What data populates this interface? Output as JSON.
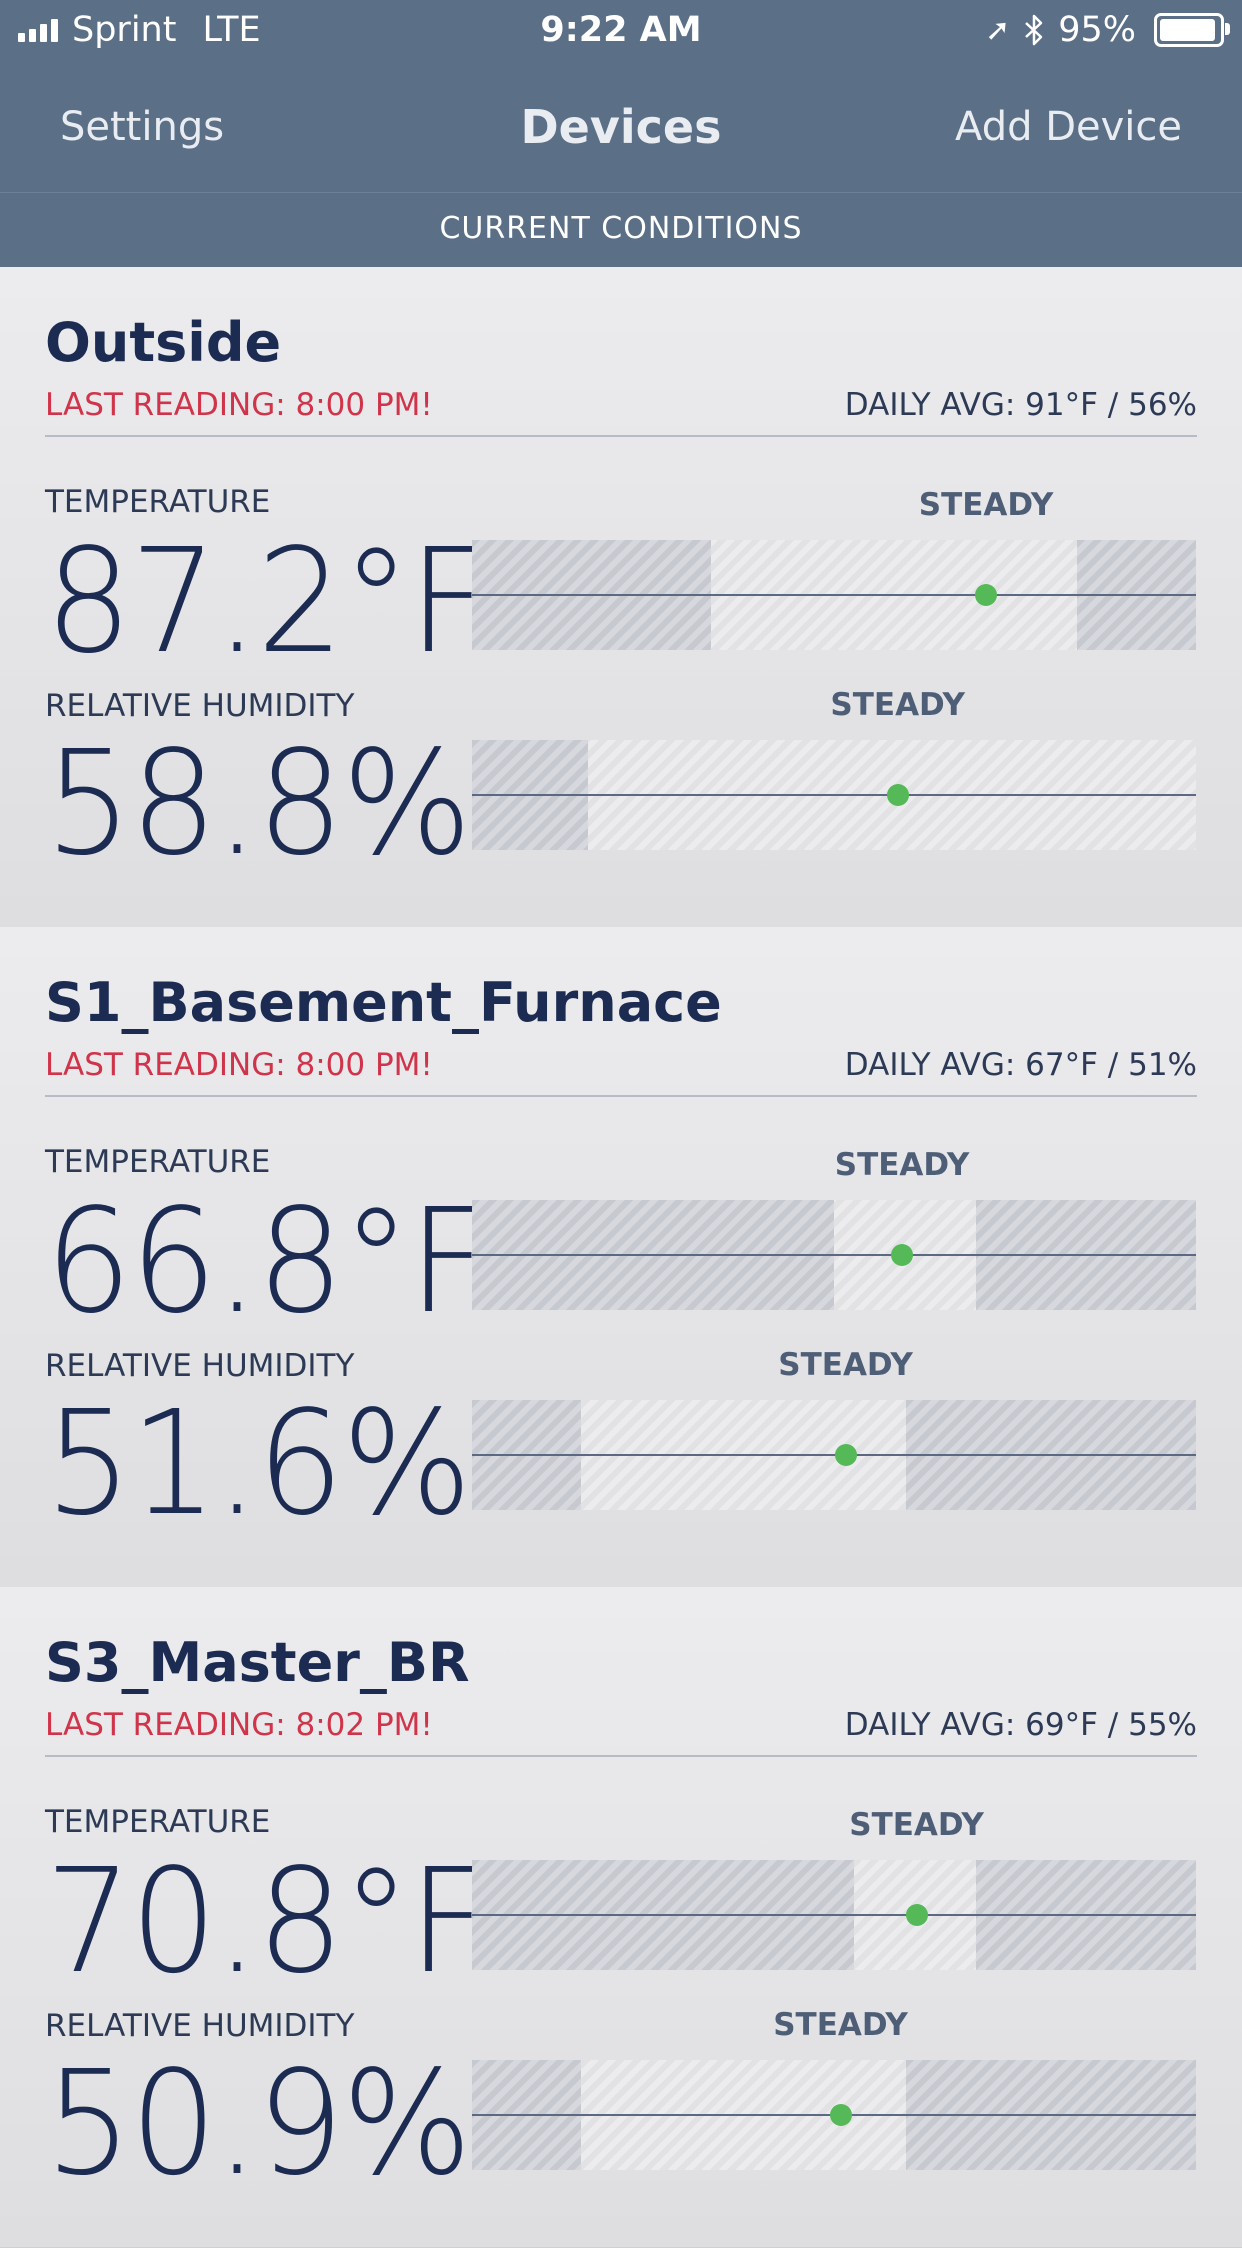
{
  "status_bar": {
    "carrier": "Sprint",
    "network": "LTE",
    "time": "9:22 AM",
    "battery": "95%",
    "battery_level": 0.95,
    "icons": [
      "signal-icon",
      "location-arrow-icon",
      "bluetooth-icon",
      "battery-icon"
    ]
  },
  "nav": {
    "left": "Settings",
    "title": "Devices",
    "right": "Add Device"
  },
  "subheader": "CURRENT CONDITIONS",
  "colors": {
    "nav_bar": "#5b6f87",
    "title_text": "#1c2b52",
    "warning_text": "#d0344a",
    "indicator": "#55b958"
  },
  "devices": [
    {
      "name": "Outside",
      "last_reading": "LAST READING: 8:00 PM!",
      "daily_avg": "DAILY AVG: 91°F / 56%",
      "temperature": {
        "label": "TEMPERATURE",
        "value": "87.2°F",
        "trend": "STEADY",
        "indicator_pos": 0.71,
        "out_of_range": [
          [
            0,
            0.33
          ],
          [
            0.835,
            1
          ]
        ]
      },
      "humidity": {
        "label": "RELATIVE HUMIDITY",
        "value": "58.8%",
        "trend": "STEADY",
        "indicator_pos": 0.588,
        "out_of_range": [
          [
            0,
            0.16
          ]
        ]
      }
    },
    {
      "name": "S1_Basement_Furnace",
      "last_reading": "LAST READING: 8:00 PM!",
      "daily_avg": "DAILY AVG: 67°F / 51%",
      "temperature": {
        "label": "TEMPERATURE",
        "value": "66.8°F",
        "trend": "STEADY",
        "indicator_pos": 0.594,
        "out_of_range": [
          [
            0,
            0.5
          ],
          [
            0.696,
            1
          ]
        ]
      },
      "humidity": {
        "label": "RELATIVE HUMIDITY",
        "value": "51.6%",
        "trend": "STEADY",
        "indicator_pos": 0.516,
        "out_of_range": [
          [
            0,
            0.15
          ],
          [
            0.6,
            1
          ]
        ]
      }
    },
    {
      "name": "S3_Master_BR",
      "last_reading": "LAST READING: 8:02 PM!",
      "daily_avg": "DAILY AVG: 69°F / 55%",
      "temperature": {
        "label": "TEMPERATURE",
        "value": "70.8°F",
        "trend": "STEADY",
        "indicator_pos": 0.614,
        "out_of_range": [
          [
            0,
            0.527
          ],
          [
            0.696,
            1
          ]
        ]
      },
      "humidity": {
        "label": "RELATIVE HUMIDITY",
        "value": "50.9%",
        "trend": "STEADY",
        "indicator_pos": 0.509,
        "out_of_range": [
          [
            0,
            0.15
          ],
          [
            0.6,
            1
          ]
        ]
      }
    }
  ]
}
